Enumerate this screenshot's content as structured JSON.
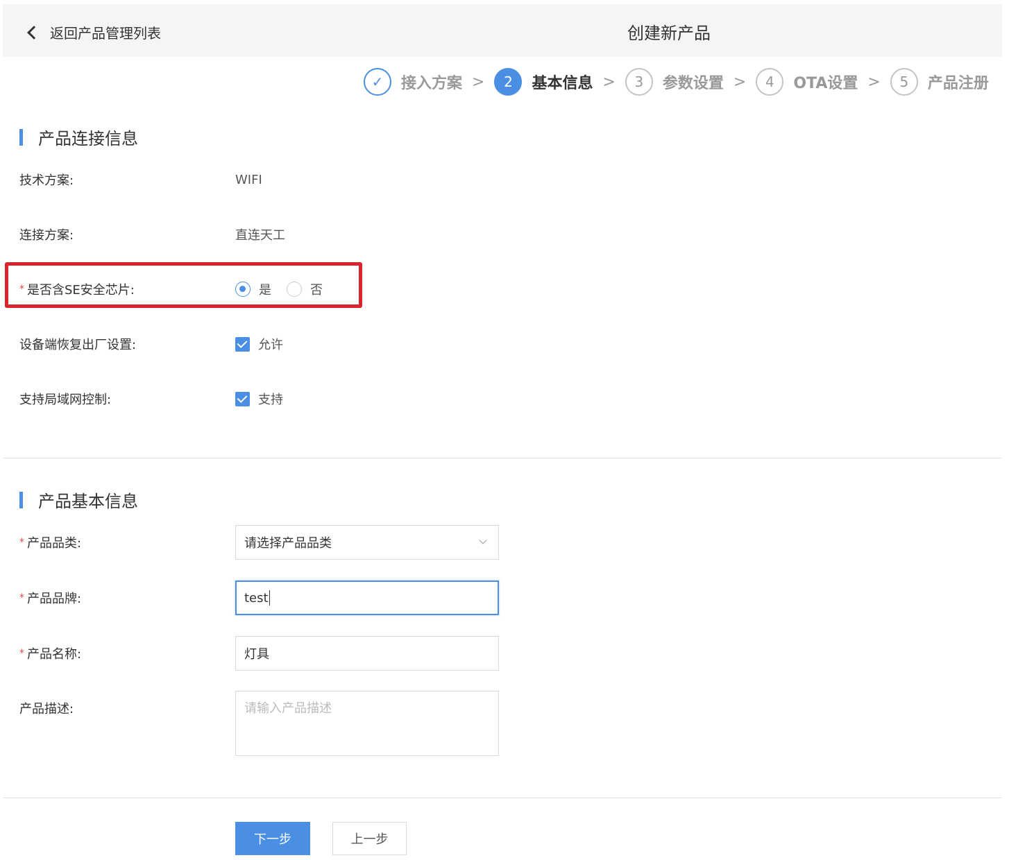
{
  "header": {
    "back_label": "返回产品管理列表",
    "title": "创建新产品"
  },
  "steps": [
    {
      "num": "✓",
      "label": "接入方案",
      "state": "done"
    },
    {
      "num": "2",
      "label": "基本信息",
      "state": "active"
    },
    {
      "num": "3",
      "label": "参数设置",
      "state": "todo"
    },
    {
      "num": "4",
      "label": "OTA设置",
      "state": "todo"
    },
    {
      "num": "5",
      "label": "产品注册",
      "state": "todo"
    }
  ],
  "step_separator": ">",
  "connection": {
    "title": "产品连接信息",
    "tech_label": "技术方案:",
    "tech_value": "WIFI",
    "conn_label": "连接方案:",
    "conn_value": "直连天工",
    "se_label": "是否含SE安全芯片:",
    "se_yes": "是",
    "se_no": "否",
    "se_selected": "是",
    "reset_label": "设备端恢复出厂设置:",
    "reset_option": "允许",
    "lan_label": "支持局域网控制:",
    "lan_option": "支持"
  },
  "basic": {
    "title": "产品基本信息",
    "category_label": "产品品类:",
    "category_placeholder": "请选择产品品类",
    "brand_label": "产品品牌:",
    "brand_value": "test",
    "name_label": "产品名称:",
    "name_value": "灯具",
    "desc_label": "产品描述:",
    "desc_placeholder": "请输入产品描述"
  },
  "required_mark": "*",
  "actions": {
    "next": "下一步",
    "prev": "上一步"
  },
  "colors": {
    "accent": "#4a8fe4",
    "required": "#e0454a",
    "highlight": "#d9232d"
  }
}
